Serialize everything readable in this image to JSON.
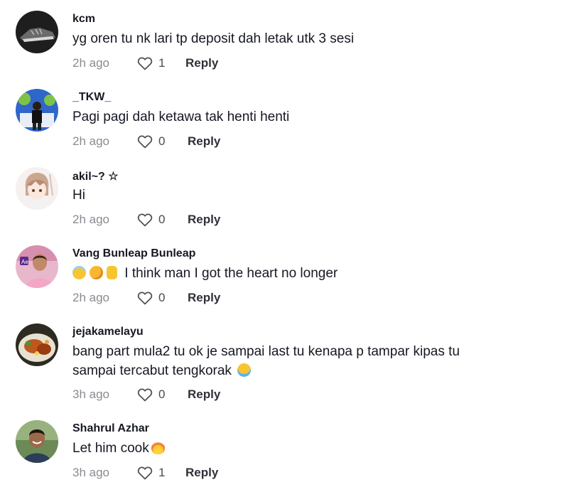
{
  "comments": [
    {
      "username": "kcm",
      "text": "yg oren tu nk lari tp deposit dah letak utk 3 sesi",
      "time": "2h ago",
      "likes": "1",
      "reply": "Reply",
      "avatar_color": "#2b2b2b"
    },
    {
      "username": "_TKW_",
      "text": "Pagi pagi dah ketawa tak henti henti",
      "time": "2h ago",
      "likes": "0",
      "reply": "Reply",
      "avatar_color": "#3c6fd1"
    },
    {
      "username": "akil~? ☆",
      "text": "Hi",
      "time": "2h ago",
      "likes": "0",
      "reply": "Reply",
      "avatar_color": "#f3e8e4"
    },
    {
      "username": "Vang Bunleap Bunleap",
      "text": "I think man I got the heart no longer",
      "emojis": [
        "smiling-halo-emoji",
        "rolling-laughing-emoji",
        "thumbs-up-emoji"
      ],
      "time": "2h ago",
      "likes": "0",
      "reply": "Reply",
      "avatar_color": "#e7b3c6"
    },
    {
      "username": "jejakamelayu",
      "text_line1": "bang part mula2 tu ok je sampai last tu kenapa p tampar kipas tu",
      "text_line2": "sampai tercabut tengkorak",
      "emoji": "crying-face-emoji",
      "time": "3h ago",
      "likes": "0",
      "reply": "Reply",
      "avatar_color": "#8a5a2b"
    },
    {
      "username": "Shahrul Azhar",
      "text": "Let him cook",
      "emoji": "fire-emoji",
      "time": "3h ago",
      "likes": "1",
      "reply": "Reply",
      "avatar_color": "#5c7a4a"
    }
  ]
}
